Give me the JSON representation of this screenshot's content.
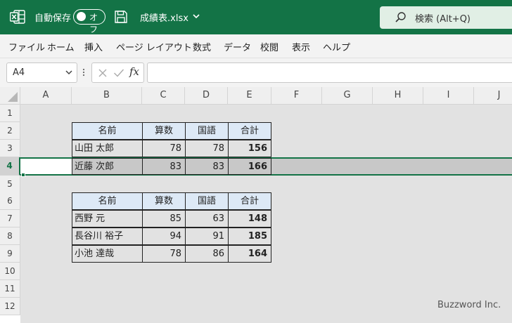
{
  "titlebar": {
    "autosave_label": "自動保存",
    "autosave_state": "オフ",
    "filename": "成績表.xlsx",
    "search_placeholder": "検索 (Alt+Q)"
  },
  "ribbon": {
    "tabs": [
      "ファイル",
      "ホーム",
      "挿入",
      "ページ レイアウト",
      "数式",
      "データ",
      "校閲",
      "表示",
      "ヘルプ"
    ]
  },
  "formula_bar": {
    "name_box": "A4",
    "fx": "fx",
    "formula": ""
  },
  "columns": [
    "A",
    "B",
    "C",
    "D",
    "E",
    "F",
    "G",
    "H",
    "I",
    "J"
  ],
  "rows": [
    "1",
    "2",
    "3",
    "4",
    "5",
    "6",
    "7",
    "8",
    "9",
    "10",
    "11",
    "12"
  ],
  "selected_row": "4",
  "table1": {
    "headers": [
      "名前",
      "算数",
      "国語",
      "合計"
    ],
    "rows": [
      [
        "山田 太郎",
        "78",
        "78",
        "156"
      ],
      [
        "近藤 次郎",
        "83",
        "83",
        "166"
      ]
    ]
  },
  "table2": {
    "headers": [
      "名前",
      "算数",
      "国語",
      "合計"
    ],
    "rows": [
      [
        "西野 元",
        "85",
        "63",
        "148"
      ],
      [
        "長谷川 裕子",
        "94",
        "91",
        "185"
      ],
      [
        "小池 達哉",
        "78",
        "86",
        "164"
      ]
    ]
  },
  "watermark": "Buzzword Inc.",
  "colors": {
    "excel_green": "#137346",
    "header_fill": "#dde9f6",
    "selection_fill": "#c8c8c8"
  }
}
